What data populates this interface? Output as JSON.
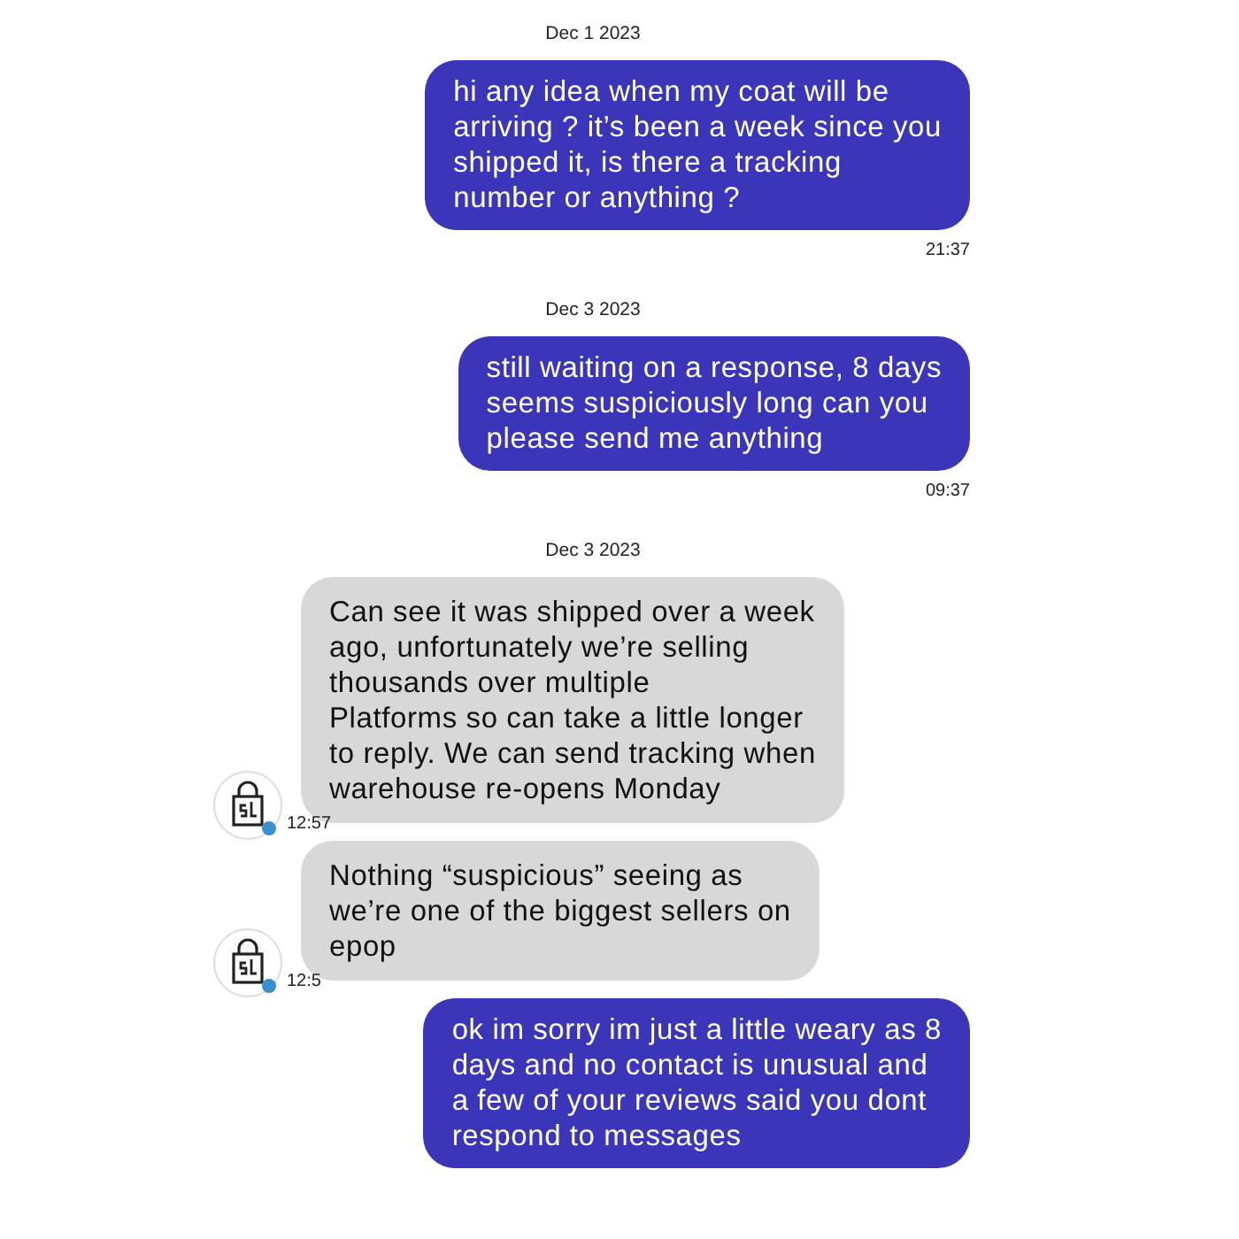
{
  "messages": [
    {
      "kind": "date",
      "text": "Dec 1 2023"
    },
    {
      "kind": "sent",
      "text": "hi any idea when my coat will be\narriving ? it’s been a week since you\nshipped it, is there a tracking\nnumber or anything ?",
      "time": "21:37"
    },
    {
      "kind": "date",
      "text": "Dec 3 2023"
    },
    {
      "kind": "sent",
      "text": "still waiting on a response, 8 days\nseems suspiciously long can you\nplease send me anything",
      "time": "09:37"
    },
    {
      "kind": "date",
      "text": "Dec 3 2023"
    },
    {
      "kind": "received",
      "text": "Can see it was shipped over a week\nago, unfortunately we’re selling\nthousands over multiple\nPlatforms so can take a little longer\nto reply. We can send tracking when\nwarehouse re-opens Monday",
      "time": "12:57"
    },
    {
      "kind": "received",
      "text": "Nothing “suspicious” seeing as\nwe’re one of the biggest sellers on\n  epop",
      "time": "12:5"
    },
    {
      "kind": "sent",
      "text": "ok im sorry im just a little weary as 8\ndays and no contact is unusual and\na few of your reviews said you dont\nrespond to messages"
    }
  ]
}
